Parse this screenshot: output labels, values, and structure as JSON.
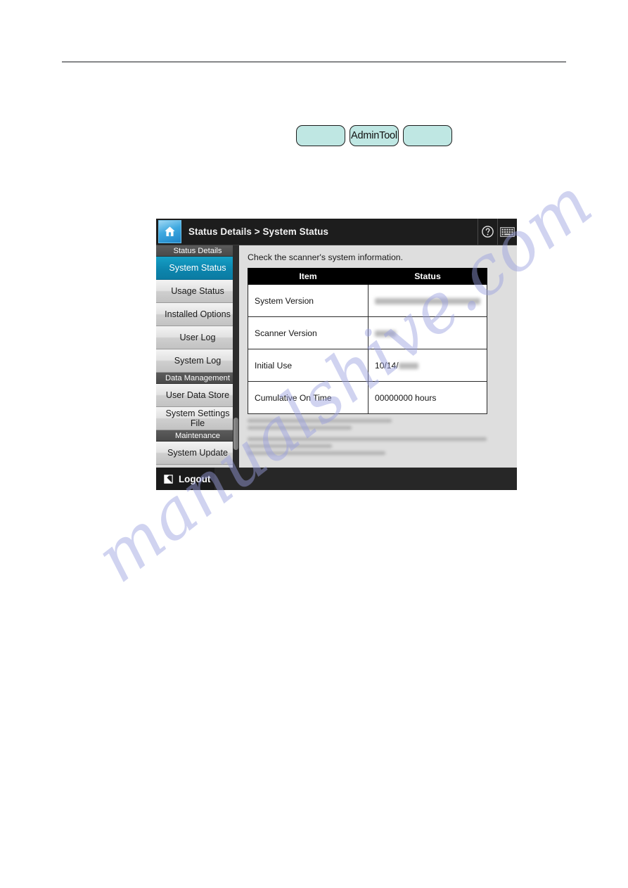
{
  "document": {
    "background_color": "#ffffff",
    "rule_color": "#868789",
    "watermark_text": "manualshive.com",
    "watermark_color": "#9aa0e0"
  },
  "callouts": {
    "buttons": [
      {
        "label": "",
        "name": "callout-button-left"
      },
      {
        "label": "AdminTool",
        "name": "callout-button-admintool"
      },
      {
        "label": "",
        "name": "callout-button-right"
      }
    ],
    "fill_color": "#bfe7e3",
    "border_color": "#1c1c1c"
  },
  "panel": {
    "header": {
      "home_icon": "home-icon",
      "title": "Status Details > System Status",
      "breadcrumb_parent": "Status Details",
      "breadcrumb_separator": ">",
      "breadcrumb_current": "System Status",
      "tools": [
        {
          "name": "help-icon",
          "label": "?"
        },
        {
          "name": "keyboard-icon",
          "label": ""
        }
      ]
    },
    "sidebar": {
      "accent_color": "#0d86ae",
      "entries": [
        {
          "type": "group",
          "label": "Status Details"
        },
        {
          "type": "item",
          "label": "System Status",
          "active": true
        },
        {
          "type": "item",
          "label": "Usage Status",
          "active": false
        },
        {
          "type": "item",
          "label": "Installed Options",
          "active": false
        },
        {
          "type": "item",
          "label": "User Log",
          "active": false
        },
        {
          "type": "item",
          "label": "System Log",
          "active": false
        },
        {
          "type": "group",
          "label": "Data Management"
        },
        {
          "type": "item",
          "label": "User Data Store",
          "active": false
        },
        {
          "type": "item",
          "label": "System Settings File",
          "active": false
        },
        {
          "type": "group",
          "label": "Maintenance"
        },
        {
          "type": "item",
          "label": "System Update",
          "active": false
        }
      ]
    },
    "content": {
      "description": "Check the scanner's system information.",
      "table": {
        "columns": [
          "Item",
          "Status"
        ],
        "rows": [
          {
            "item": "System Version",
            "status": "",
            "redacted": true,
            "redact_width": 150
          },
          {
            "item": "Scanner Version",
            "status": "",
            "redacted": true,
            "redact_width": 30
          },
          {
            "item": "Initial Use",
            "status": "10/14/",
            "redacted": true,
            "redact_width": 28
          },
          {
            "item": "Cumulative On Time",
            "status": "00000000 hours",
            "redacted": false,
            "redact_width": 0
          }
        ]
      },
      "legal_note_redacted": true
    },
    "footer": {
      "logout_label": "Logout",
      "logout_icon": "logout-icon"
    }
  }
}
